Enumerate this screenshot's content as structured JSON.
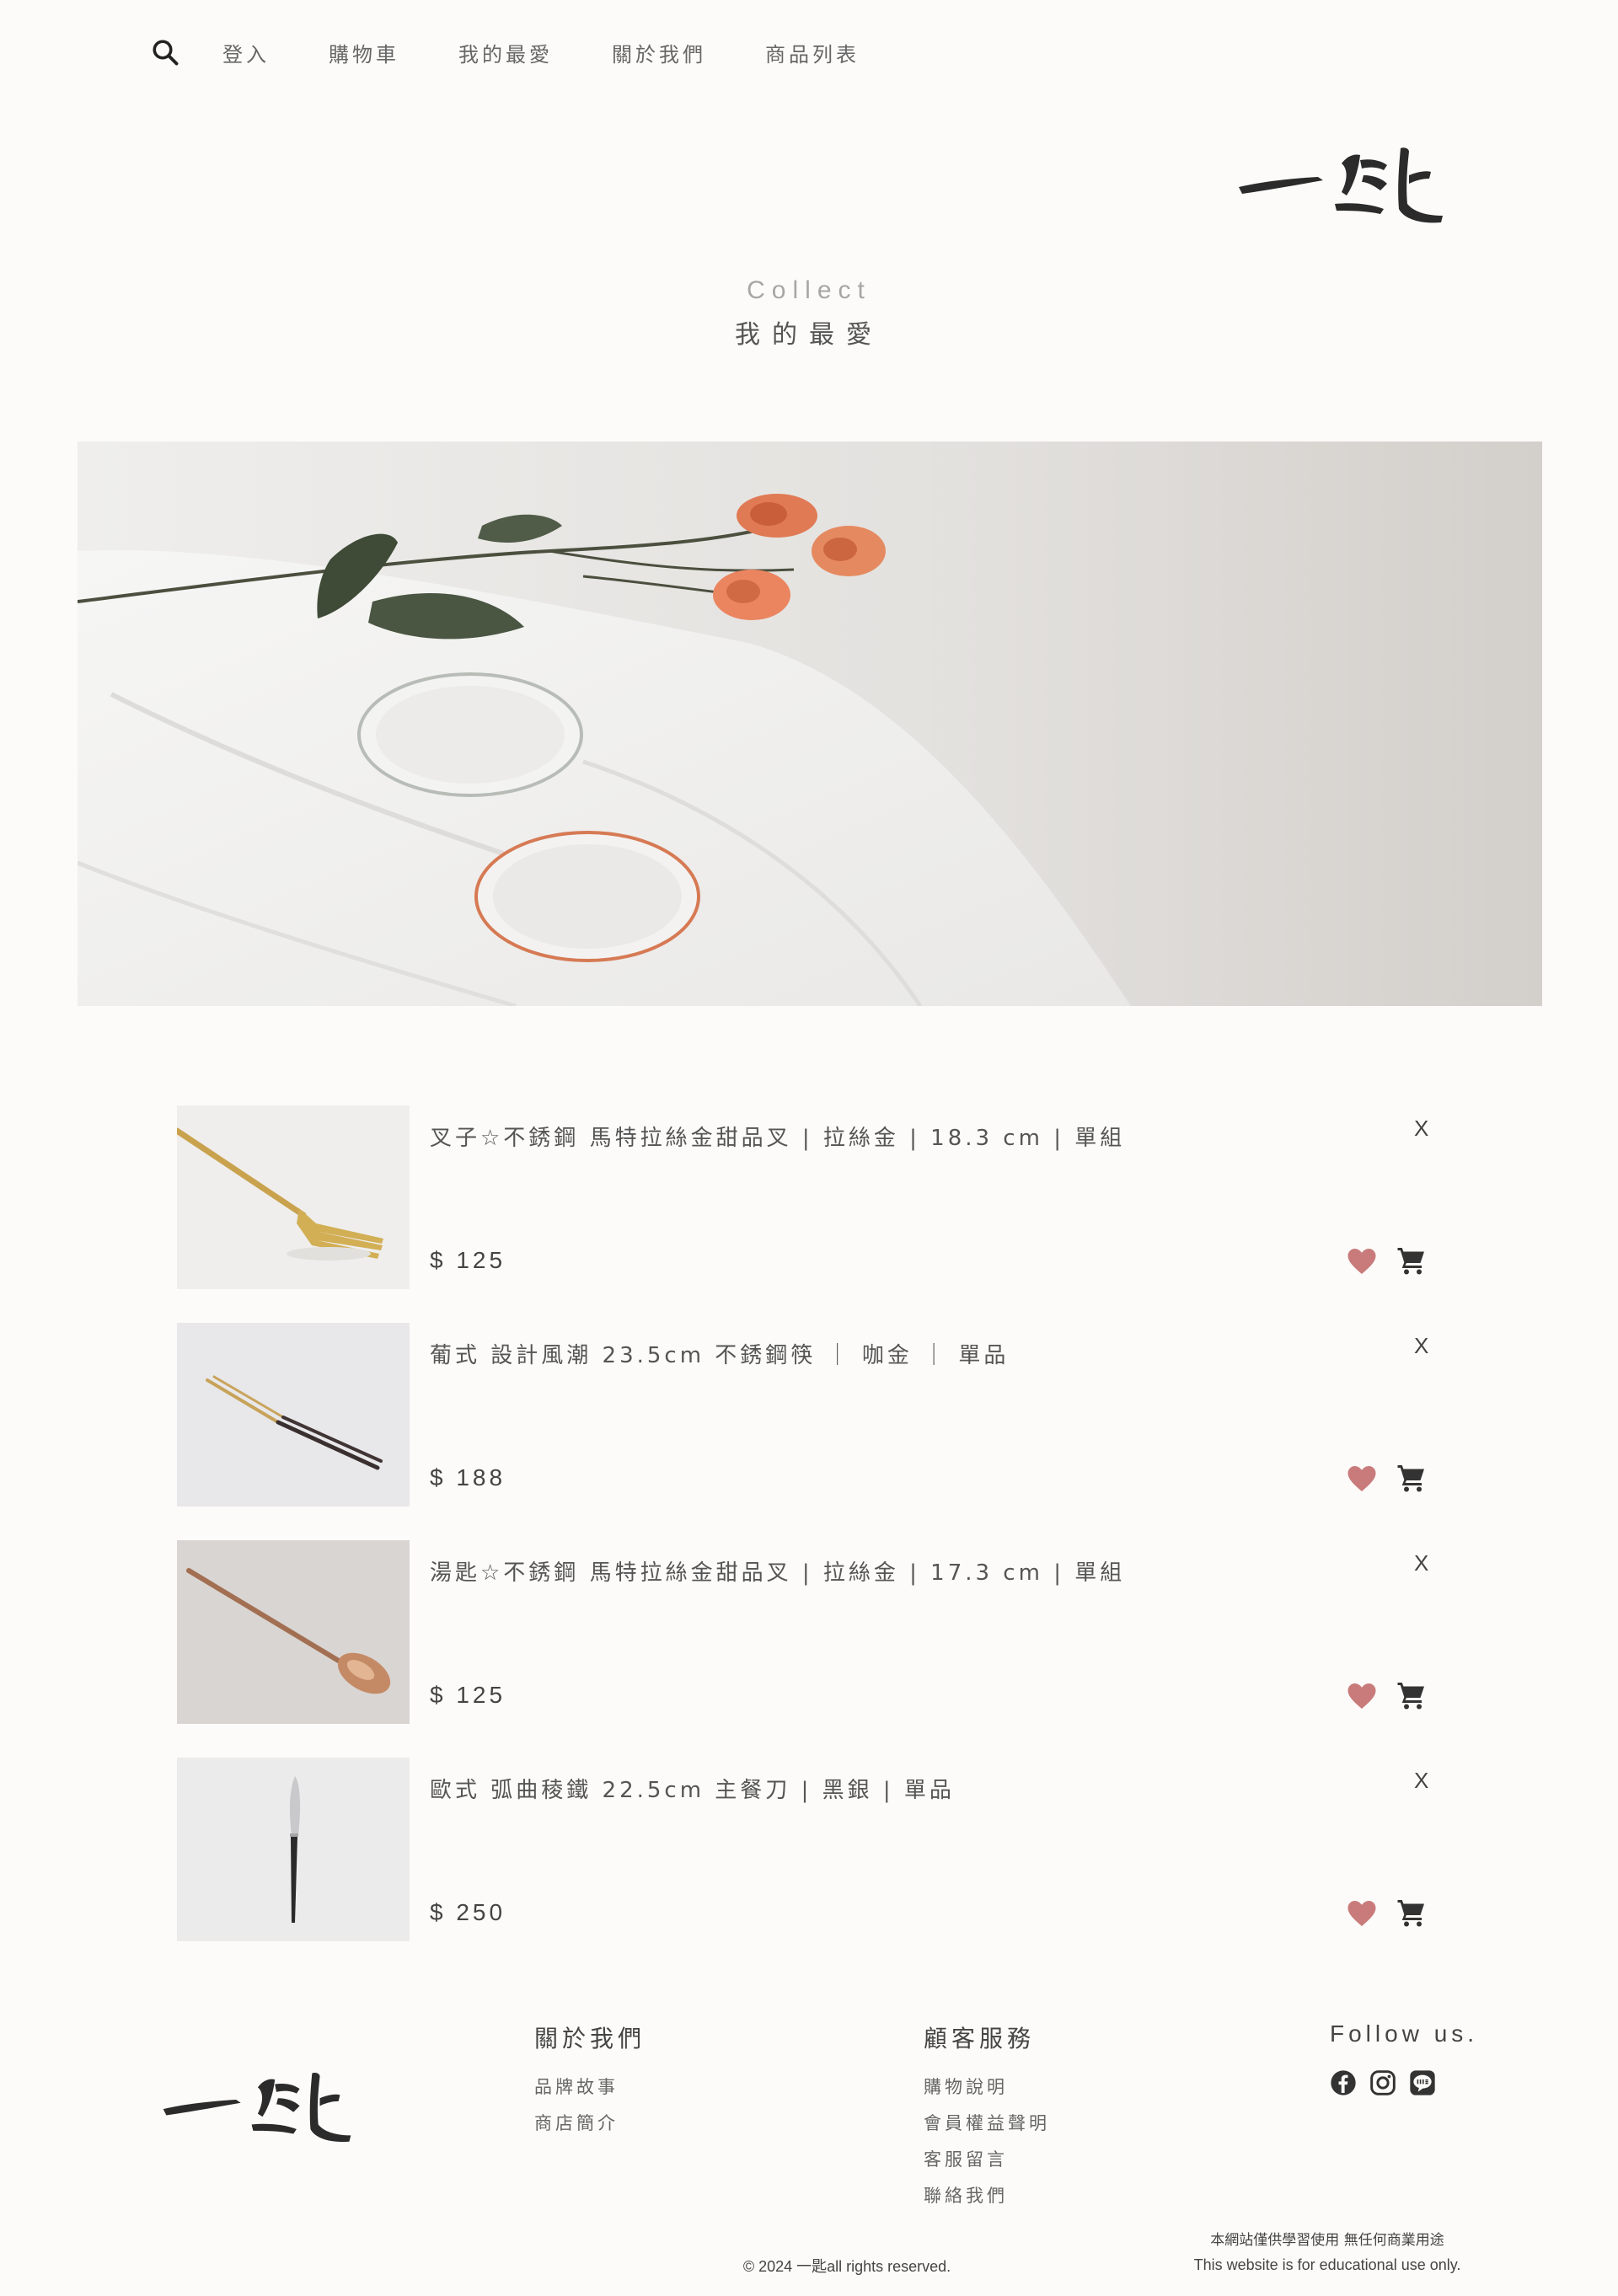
{
  "nav": {
    "search_icon": "search-icon",
    "links": [
      "登入",
      "購物車",
      "我的最愛",
      "關於我們",
      "商品列表"
    ]
  },
  "heading": {
    "en": "Collect",
    "zh": "我的最愛"
  },
  "favorites": [
    {
      "name": "叉子☆不銹鋼 馬特拉絲金甜品叉 | 拉絲金 | 18.3 cm | 單組",
      "price": "$ 125",
      "remove": "X"
    },
    {
      "name": "葡式 設計風潮 23.5cm 不銹鋼筷 ｜ 咖金 ｜ 單品",
      "price": "$ 188",
      "remove": "X"
    },
    {
      "name": "湯匙☆不銹鋼 馬特拉絲金甜品叉 | 拉絲金 | 17.3 cm | 單組",
      "price": "$ 125",
      "remove": "X"
    },
    {
      "name": "歐式 弧曲稜鐵 22.5cm 主餐刀 | 黑銀 | 單品",
      "price": "$ 250",
      "remove": "X"
    }
  ],
  "footer": {
    "about": {
      "title": "關於我們",
      "links": [
        "品牌故事",
        "商店簡介"
      ]
    },
    "service": {
      "title": "顧客服務",
      "links": [
        "購物說明",
        "會員權益聲明",
        "客服留言",
        "聯絡我們"
      ]
    },
    "follow": {
      "title": "Follow us.",
      "icons": [
        "facebook-icon",
        "instagram-icon",
        "line-icon"
      ]
    },
    "copyright": "© 2024 一匙all rights reserved.",
    "note_zh": "本網站僅供學習使用 無任何商業用途",
    "note_en": "This website is for educational use only."
  },
  "colors": {
    "heart": "#c97b7b",
    "text": "#555555",
    "background": "#fcfbf9"
  }
}
